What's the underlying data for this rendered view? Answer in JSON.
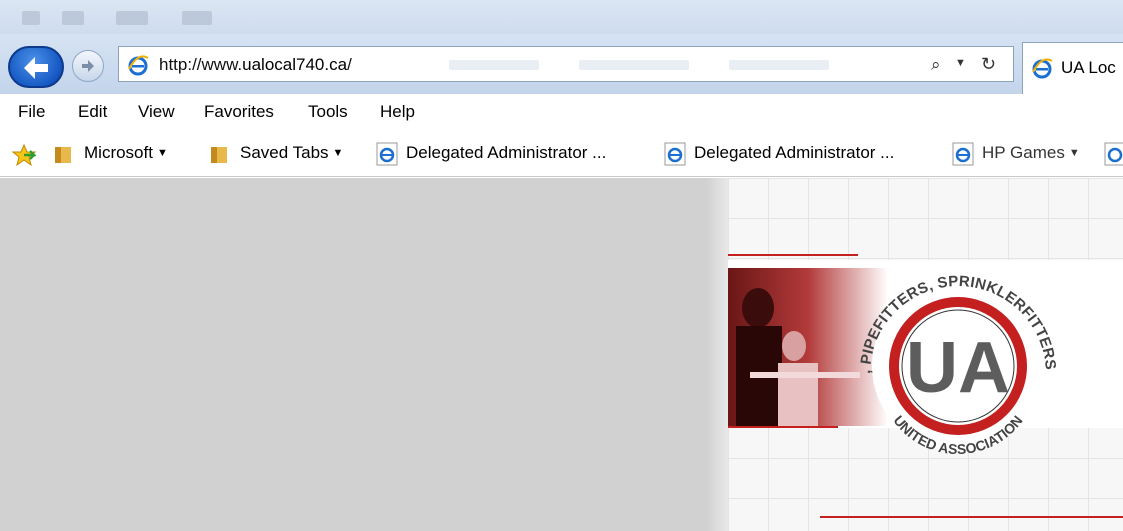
{
  "browser": {
    "back_label": "Back",
    "forward_label": "Forward",
    "address": {
      "prefix": "http://www.",
      "domain": "ualocal740.ca",
      "suffix": "/"
    },
    "tab_title": "UA Loc"
  },
  "menubar": {
    "items": [
      "File",
      "Edit",
      "View",
      "Favorites",
      "Tools",
      "Help"
    ]
  },
  "favorites_bar": {
    "items": [
      {
        "label": "Microsoft",
        "type": "folder",
        "dropdown": true
      },
      {
        "label": "Saved Tabs",
        "type": "folder",
        "dropdown": true
      },
      {
        "label": "Delegated Administrator ...",
        "type": "link"
      },
      {
        "label": "Delegated Administrator ...",
        "type": "link"
      },
      {
        "label": "HP Games",
        "type": "link",
        "dropdown": true
      }
    ]
  },
  "website": {
    "logo_letters": "UA",
    "seal_top_text": "UNION PLUMBERS, PIPEFITTERS, SPRINKLERFITTERS & SERVICE TECHS",
    "seal_bottom_text": "UNITED ASSOCIATION",
    "accent_color": "#c42020"
  },
  "colors": {
    "toolbar_bg": "#c9d8ec",
    "content_bg": "#d1d1d1",
    "ie_blue": "#1a6fd1"
  }
}
